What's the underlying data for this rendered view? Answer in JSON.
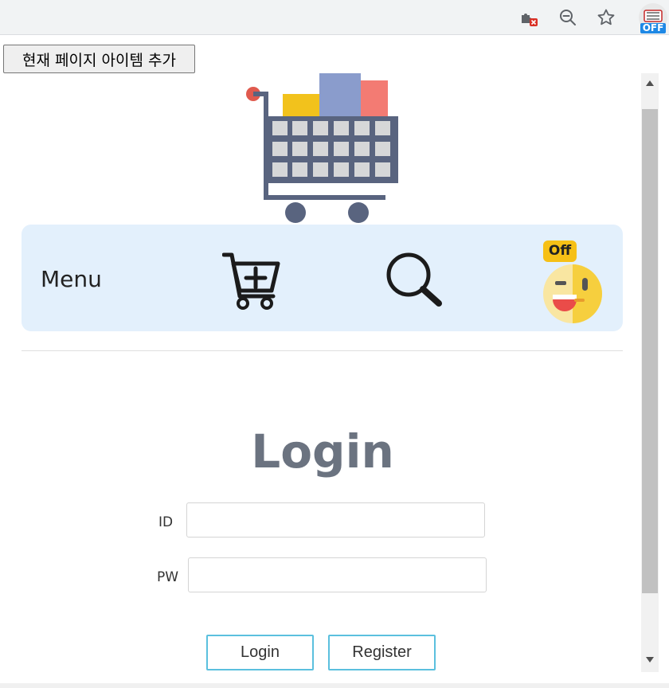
{
  "browser": {
    "icons": [
      "extensions-blocked-icon",
      "zoom-out-icon",
      "bookmark-star-icon"
    ],
    "extension_badge": "OFF"
  },
  "toolbar": {
    "add_item_label": "현재 페이지 아이템 추가"
  },
  "menu": {
    "label": "Menu",
    "off_badge": "Off"
  },
  "login": {
    "title": "Login",
    "id_label": "ID",
    "id_value": "",
    "pw_label": "PW",
    "pw_value": "",
    "login_button": "Login",
    "register_button": "Register"
  },
  "colors": {
    "menu_bg": "#e3f0fc",
    "button_border": "#5bc0de",
    "title_color": "#6b7380",
    "badge": "#f6c016"
  }
}
